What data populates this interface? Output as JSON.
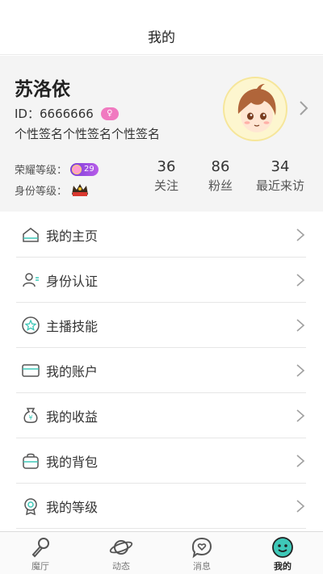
{
  "header": {
    "title": "我的"
  },
  "profile": {
    "name": "苏洛依",
    "id_label": "ID：",
    "id_value": "6666666",
    "signature": "个性签名个性签名个性签名",
    "honor_level_label": "荣耀等级：",
    "honor_level_value": "29",
    "identity_level_label": "身份等级："
  },
  "stats": [
    {
      "value": "36",
      "label": "关注"
    },
    {
      "value": "86",
      "label": "粉丝"
    },
    {
      "value": "34",
      "label": "最近来访"
    }
  ],
  "menu": [
    {
      "label": "我的主页",
      "icon": "home-icon"
    },
    {
      "label": "身份认证",
      "icon": "identity-verify-icon"
    },
    {
      "label": "主播技能",
      "icon": "star-skill-icon"
    },
    {
      "label": "我的账户",
      "icon": "card-icon"
    },
    {
      "label": "我的收益",
      "icon": "money-bag-icon"
    },
    {
      "label": "我的背包",
      "icon": "backpack-icon"
    },
    {
      "label": "我的等级",
      "icon": "medal-icon"
    }
  ],
  "tabs": [
    {
      "label": "魔厅",
      "icon": "microphone-icon",
      "active": false
    },
    {
      "label": "动态",
      "icon": "planet-icon",
      "active": false
    },
    {
      "label": "消息",
      "icon": "heart-message-icon",
      "active": false
    },
    {
      "label": "我的",
      "icon": "smiley-icon",
      "active": true
    }
  ],
  "colors": {
    "accent": "#3ec8b8",
    "gender": "#f07ac0",
    "honor_badge": "#8a45dd",
    "profile_bg": "#f4f4f4"
  }
}
